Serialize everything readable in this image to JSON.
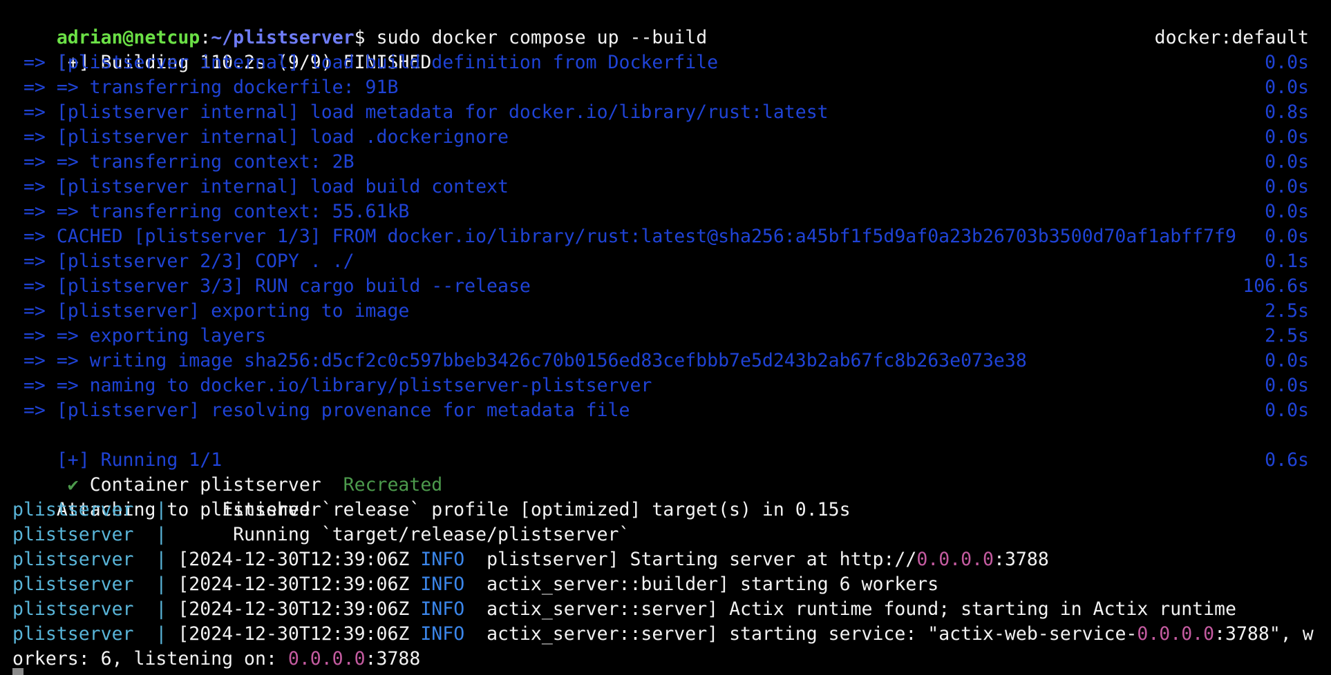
{
  "prompt": {
    "user_host": "adrian@netcup",
    "separator": ":",
    "path": "~/plistserver",
    "symbol": "$ ",
    "command": "sudo docker compose up --build"
  },
  "build_header": {
    "text": "[+] Building 110.2s (9/9) FINISHED",
    "context": "docker:default"
  },
  "build_steps": [
    {
      "text": " => [plistserver internal] load build definition from Dockerfile",
      "duration": "0.0s"
    },
    {
      "text": " => => transferring dockerfile: 91B",
      "duration": "0.0s"
    },
    {
      "text": " => [plistserver internal] load metadata for docker.io/library/rust:latest",
      "duration": "0.8s"
    },
    {
      "text": " => [plistserver internal] load .dockerignore",
      "duration": "0.0s"
    },
    {
      "text": " => => transferring context: 2B",
      "duration": "0.0s"
    },
    {
      "text": " => [plistserver internal] load build context",
      "duration": "0.0s"
    },
    {
      "text": " => => transferring context: 55.61kB",
      "duration": "0.0s"
    },
    {
      "text": " => CACHED [plistserver 1/3] FROM docker.io/library/rust:latest@sha256:a45bf1f5d9af0a23b26703b3500d70af1abff7f9",
      "duration": "0.0s"
    },
    {
      "text": " => [plistserver 2/3] COPY . ./",
      "duration": "0.1s"
    },
    {
      "text": " => [plistserver 3/3] RUN cargo build --release",
      "duration": "106.6s"
    },
    {
      "text": " => [plistserver] exporting to image",
      "duration": "2.5s"
    },
    {
      "text": " => => exporting layers",
      "duration": "2.5s"
    },
    {
      "text": " => => writing image sha256:d5cf2c0c597bbeb3426c70b0156ed83cefbbb7e5d243b2ab67fc8b263e073e38",
      "duration": "0.0s"
    },
    {
      "text": " => => naming to docker.io/library/plistserver-plistserver",
      "duration": "0.0s"
    },
    {
      "text": " => [plistserver] resolving provenance for metadata file",
      "duration": "0.0s"
    }
  ],
  "running_header": "[+] Running 1/1",
  "container_status": {
    "check": " ✔ ",
    "label": "Container plistserver  ",
    "status": "Recreated",
    "duration": "0.6s"
  },
  "attaching": "Attaching to plistserver",
  "log_lines": [
    {
      "prefix": "plistserver  | ",
      "message": "    Finished `release` profile [optimized] target(s) in 0.15s"
    },
    {
      "prefix": "plistserver  | ",
      "message": "     Running `target/release/plistserver`"
    }
  ],
  "info_lines": [
    {
      "prefix": "plistserver  | ",
      "timestamp": "[2024-12-30T12:39:06Z ",
      "level": "INFO",
      "module": "  plistserver] ",
      "msg_before": "Starting server at http://",
      "ip": "0.0.0.0",
      "msg_after": ":3788"
    },
    {
      "prefix": "plistserver  | ",
      "timestamp": "[2024-12-30T12:39:06Z ",
      "level": "INFO",
      "module": "  actix_server::builder] ",
      "msg_before": "starting 6 workers",
      "ip": "",
      "msg_after": ""
    },
    {
      "prefix": "plistserver  | ",
      "timestamp": "[2024-12-30T12:39:06Z ",
      "level": "INFO",
      "module": "  actix_server::server] ",
      "msg_before": "Actix runtime found; starting in Actix runtime",
      "ip": "",
      "msg_after": ""
    },
    {
      "prefix": "plistserver  | ",
      "timestamp": "[2024-12-30T12:39:06Z ",
      "level": "INFO",
      "module": "  actix_server::server] ",
      "msg_before": "starting service: \"actix-web-service-",
      "ip": "0.0.0.0",
      "msg_after": ":3788\", w"
    }
  ],
  "wrap_line": {
    "before": "orkers: 6, listening on: ",
    "ip": "0.0.0.0",
    "after": ":3788"
  },
  "colors": {
    "background": "#000000",
    "prompt_user": "#6be046",
    "prompt_path": "#6e7cf5",
    "build_blue": "#1f43d6",
    "status_green": "#4c9a4c",
    "log_prefix_cyan": "#59b5d9",
    "info_blue": "#3b86ea",
    "ip_magenta": "#c45ba0"
  }
}
